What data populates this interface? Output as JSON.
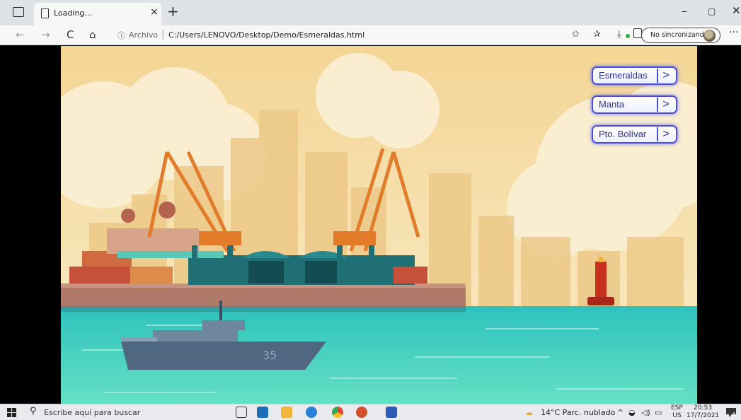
{
  "browser": {
    "tab_title": "Loading...",
    "tab_close": "×",
    "new_tab": "+",
    "address_info_icon": "ⓘ",
    "address_label": "Archivo",
    "address_separator": "|",
    "url": "C:/Users/LENOVO/Desktop/Demo/Esmeraldas.html",
    "sync_label": "No sincronizando",
    "more": "···",
    "nav": {
      "back": "←",
      "forward": "→",
      "reload": "C",
      "home": "⌂"
    },
    "window": {
      "minimize": "–",
      "maximize": "▢",
      "close": "✕"
    }
  },
  "scene": {
    "buttons": [
      {
        "label": "Esmeraldas",
        "arrow": ">"
      },
      {
        "label": "Manta",
        "arrow": ">"
      },
      {
        "label": "Pto. Bolívar",
        "arrow": ">"
      }
    ],
    "ship_number": "35",
    "colors": {
      "sky": "#f5d79a",
      "sea": "#3fd1c0",
      "button_border": "#4a4ee0",
      "button_text": "#2b3595"
    }
  },
  "taskbar": {
    "search_placeholder": "Escribe aquí para buscar",
    "weather": "14°C  Parc. nublado",
    "lang_top": "ESP",
    "lang_bottom": "US",
    "time": "20:53",
    "date": "17/7/2021",
    "notif_count": "4"
  }
}
